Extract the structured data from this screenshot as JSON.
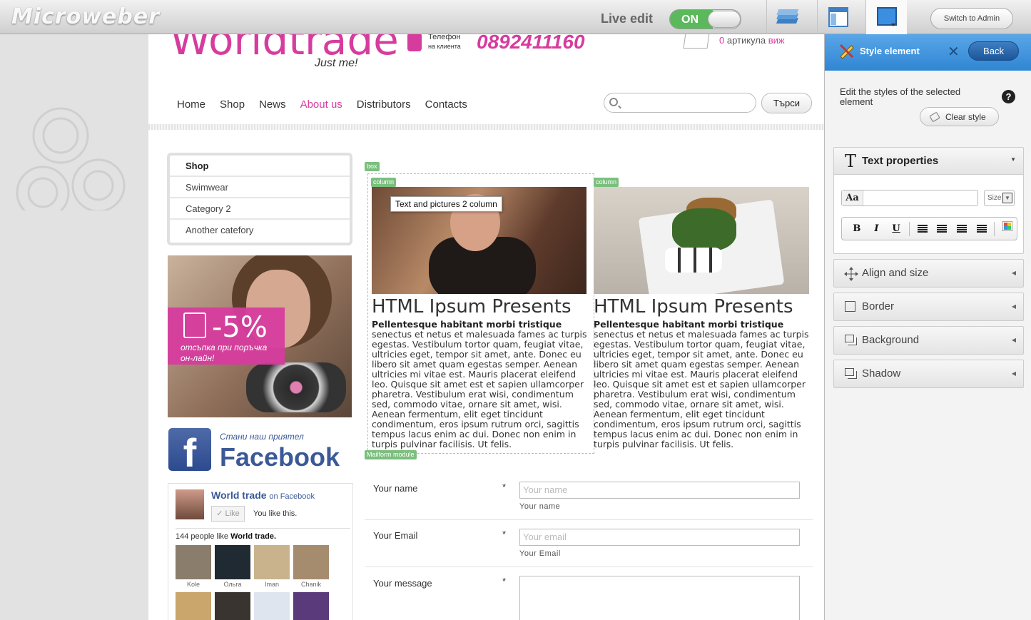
{
  "topbar": {
    "logo": "Microweber",
    "live_edit_label": "Live edit",
    "toggle_state": "ON",
    "switch_admin": "Switch to Admin"
  },
  "site": {
    "brand": "Worldtrade",
    "tagline": "Just me!",
    "phone_label_line1": "Телефон",
    "phone_label_line2": "на клиента",
    "phone_number": "0892411160",
    "cart_count": "0",
    "cart_label": "артикула",
    "cart_link": "виж",
    "nav": [
      "Home",
      "Shop",
      "News",
      "About us",
      "Distributors",
      "Contacts"
    ],
    "nav_active": "About us",
    "search_placeholder": "",
    "search_button": "Търси",
    "categories": [
      "Shop",
      "Swimwear",
      "Category 2",
      "Another catefory"
    ],
    "promo_percent": "-5%",
    "promo_text_line1": "отсъпка при поръчка",
    "promo_text_line2": "он-лайн!",
    "fb_small": "Стани наш приятел",
    "fb_big": "Facebook",
    "fb_letter": "f",
    "likebox": {
      "page_name": "World trade",
      "on_fb": "on Facebook",
      "like_btn": "✓ Like",
      "you_like": "You like this.",
      "count_text": "144 people like",
      "count_name": "World trade.",
      "fans": [
        "Kole",
        "Ольга",
        "Iman",
        "Chanik"
      ],
      "fan_colors": [
        "#8b7d6b",
        "#1f2a33",
        "#c9b38d",
        "#a58c6e",
        "#caa56c",
        "#3a3430",
        "#dfe5ee",
        "#5a3a7a"
      ]
    },
    "edit_tags": {
      "box": "box",
      "column": "column",
      "mailform": "Mailform module"
    },
    "tooltip": "Text and pictures 2 column",
    "columns": [
      {
        "title": "HTML Ipsum Presents",
        "subtitle": "Pellentesque habitant morbi tristique",
        "body": "senectus et netus et malesuada fames ac turpis egestas. Vestibulum tortor quam, feugiat vitae, ultricies eget, tempor sit amet, ante. Donec eu libero sit amet quam egestas semper. Aenean ultricies mi vitae est. Mauris placerat eleifend leo. Quisque sit amet est et sapien ullamcorper pharetra. Vestibulum erat wisi, condimentum sed, commodo vitae, ornare sit amet, wisi. Aenean fermentum, elit eget tincidunt condimentum, eros ipsum rutrum orci, sagittis tempus lacus enim ac dui. Donec non enim in turpis pulvinar facilisis. Ut felis."
      },
      {
        "title": "HTML Ipsum Presents",
        "subtitle": "Pellentesque habitant morbi tristique",
        "body": "senectus et netus et malesuada fames ac turpis egestas. Vestibulum tortor quam, feugiat vitae, ultricies eget, tempor sit amet, ante. Donec eu libero sit amet quam egestas semper. Aenean ultricies mi vitae est. Mauris placerat eleifend leo. Quisque sit amet est et sapien ullamcorper pharetra. Vestibulum erat wisi, condimentum sed, commodo vitae, ornare sit amet, wisi. Aenean fermentum, elit eget tincidunt condimentum, eros ipsum rutrum orci, sagittis tempus lacus enim ac dui. Donec non enim in turpis pulvinar facilisis. Ut felis."
      }
    ],
    "form": {
      "name_label": "Your name",
      "name_placeholder": "Your name",
      "name_hint": "Your name",
      "email_label": "Your Email",
      "email_placeholder": "Your email",
      "email_hint": "Your Email",
      "message_label": "Your message",
      "required_mark": "*"
    }
  },
  "panel": {
    "title": "Style element",
    "close": "✕",
    "back": "Back",
    "description": "Edit the styles of the selected element",
    "help": "?",
    "clear_style": "Clear style",
    "text_properties": "Text properties",
    "font_icon": "Aa",
    "size_placeholder": "Size",
    "sections": [
      "Align and size",
      "Border",
      "Background",
      "Shadow"
    ],
    "format_buttons": [
      "B",
      "I",
      "U"
    ]
  },
  "colors": {
    "accent": "#d63c9e",
    "panel_blue": "#2f86d3",
    "toggle_green": "#5cb85c",
    "facebook": "#3b5998"
  }
}
